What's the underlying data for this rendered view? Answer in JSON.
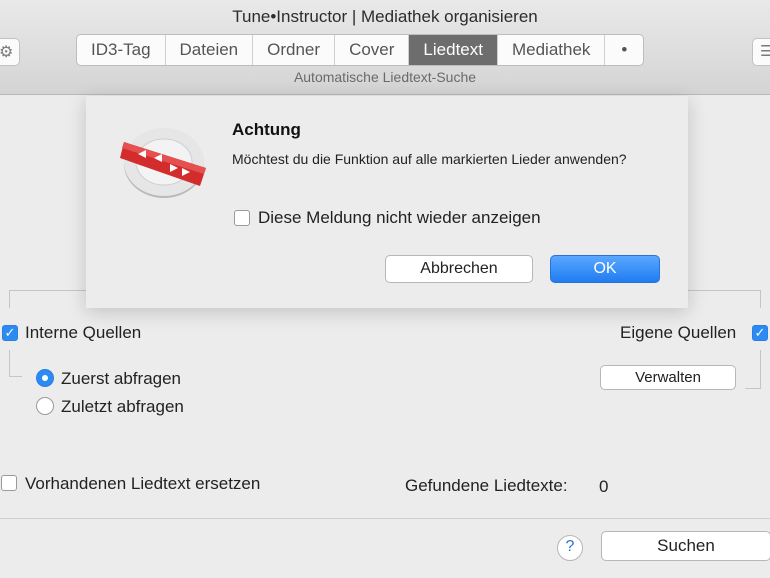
{
  "window": {
    "title": "Tune•Instructor | Mediathek organisieren",
    "subtitle": "Automatische Liedtext-Suche",
    "gear_icon": "⚙",
    "list_icon": "☰"
  },
  "tabs": [
    {
      "label": "ID3-Tag",
      "active": false
    },
    {
      "label": "Dateien",
      "active": false
    },
    {
      "label": "Ordner",
      "active": false
    },
    {
      "label": "Cover",
      "active": false
    },
    {
      "label": "Liedtext",
      "active": true
    },
    {
      "label": "Mediathek",
      "active": false
    },
    {
      "label": "•",
      "active": false
    }
  ],
  "main": {
    "interne_quellen": {
      "label": "Interne Quellen",
      "checked": true
    },
    "eigene_quellen": {
      "label": "Eigene Quellen",
      "checked": true
    },
    "radio_zuerst": {
      "label": "Zuerst abfragen",
      "selected": true
    },
    "radio_zuletzt": {
      "label": "Zuletzt abfragen",
      "selected": false
    },
    "verwalten_label": "Verwalten",
    "replace_checkbox": {
      "label": "Vorhandenen Liedtext ersetzen",
      "checked": false
    },
    "found_label": "Gefundene Liedtexte:",
    "found_count": "0",
    "help_icon": "?",
    "search_label": "Suchen"
  },
  "dialog": {
    "title": "Achtung",
    "message": "Möchtest du die Funktion auf alle markierten Lieder anwenden?",
    "checkbox_label": "Diese Meldung nicht wieder anzeigen",
    "checkbox_checked": false,
    "cancel_label": "Abbrechen",
    "ok_label": "OK",
    "accent_color": "#2c8bf2"
  }
}
